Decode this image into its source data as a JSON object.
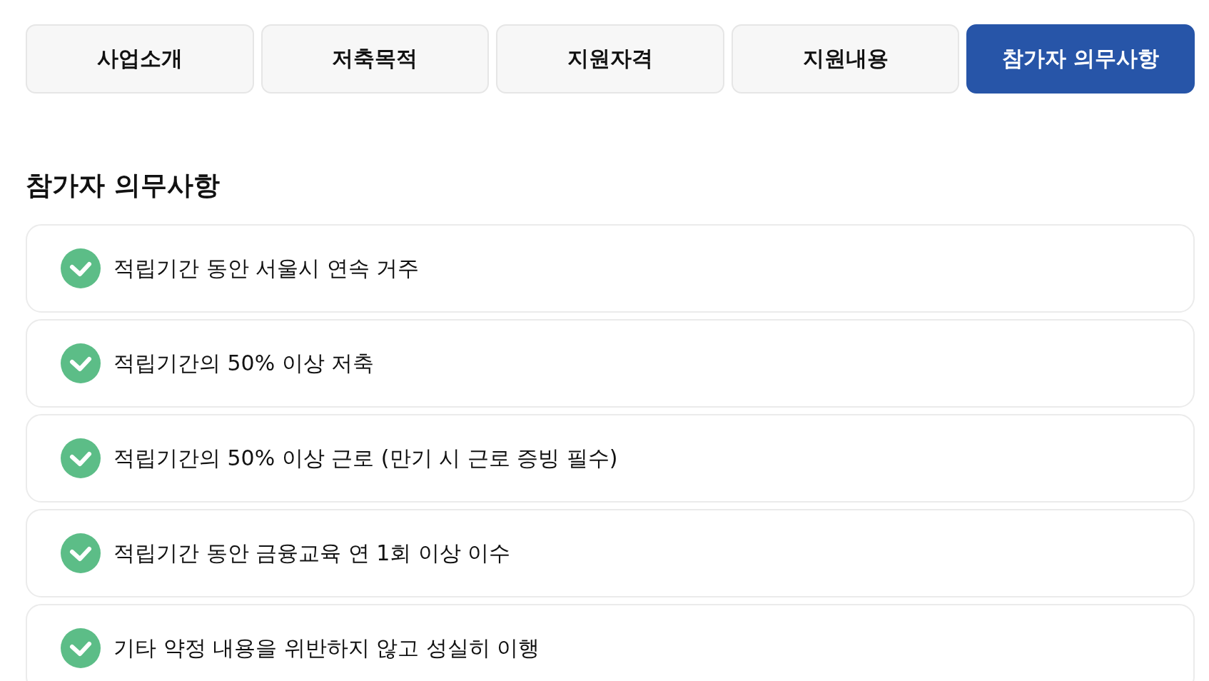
{
  "tabs": [
    {
      "label": "사업소개",
      "selected": false
    },
    {
      "label": "저축목적",
      "selected": false
    },
    {
      "label": "지원자격",
      "selected": false
    },
    {
      "label": "지원내용",
      "selected": false
    },
    {
      "label": "참가자 의무사항",
      "selected": true
    }
  ],
  "section": {
    "title": "참가자 의무사항",
    "items": [
      "적립기간 동안 서울시 연속 거주",
      "적립기간의 50% 이상 저축",
      "적립기간의 50% 이상 근로 (만기 시 근로 증빙 필수)",
      "적립기간 동안 금융교육 연 1회 이상 이수",
      "기타 약정 내용을 위반하지 않고 성실히 이행"
    ]
  }
}
